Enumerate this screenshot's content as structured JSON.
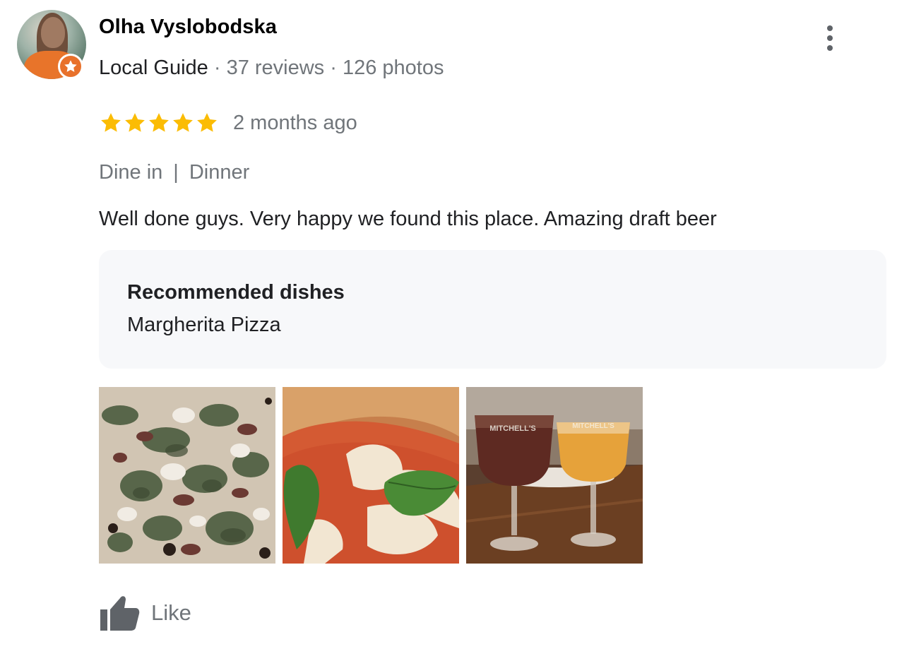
{
  "reviewer": {
    "name": "Olha Vyslobodska",
    "guide_label": "Local Guide",
    "reviews": "37 reviews",
    "photos": "126 photos",
    "separator": " · "
  },
  "review": {
    "rating": 5,
    "max_rating": 5,
    "time_ago": "2 months ago",
    "service_type": "Dine in",
    "meal_type": "Dinner",
    "service_separator": "|",
    "text": "Well done guys. Very happy we found this place. Amazing draft beer"
  },
  "recommended": {
    "title": "Recommended dishes",
    "dishes": "Margherita Pizza"
  },
  "photos": [
    {
      "subject": "pizza-with-greens"
    },
    {
      "subject": "margherita-pizza"
    },
    {
      "subject": "beer-glasses",
      "glass_text_1": "MITCHELL'S",
      "glass_text_2": "MITCHELL'S"
    }
  ],
  "actions": {
    "like_label": "Like"
  },
  "colors": {
    "star": "#fbbc04",
    "badge": "#e8712b",
    "muted_text": "#70757a",
    "box_bg": "#f7f8fa"
  },
  "icons": {
    "more": "more-vert-icon",
    "star": "star-icon",
    "like": "thumb-up-icon",
    "badge": "local-guide-badge-icon"
  }
}
